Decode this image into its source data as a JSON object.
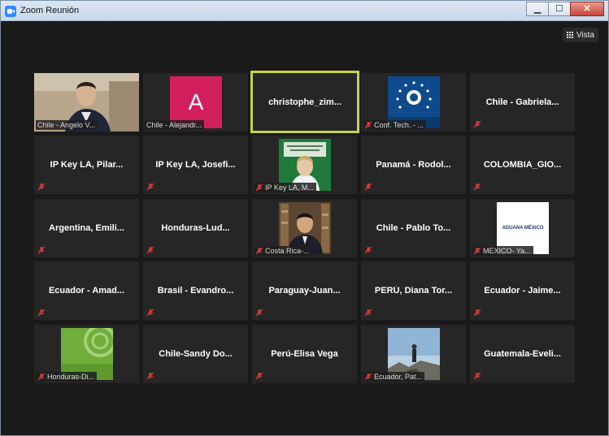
{
  "window": {
    "title": "Zoom Reunión",
    "controls": {
      "minimize": "▁",
      "maximize": "☐",
      "close": "✕"
    }
  },
  "toolbar": {
    "view_label": "Vista"
  },
  "participants": [
    {
      "id": "p1",
      "label": "Chile - Angelo V...",
      "kind": "video"
    },
    {
      "id": "p2",
      "label": "Chile - Alejandr...",
      "kind": "avatar",
      "avatar_letter": "A",
      "avatar_color": "#d41f5f"
    },
    {
      "id": "p3",
      "name": "christophe_zim...",
      "kind": "name",
      "active": true
    },
    {
      "id": "p4",
      "label": "Conf. Tech. - ...",
      "kind": "logo"
    },
    {
      "id": "p5",
      "name": "Chile - Gabriela...",
      "kind": "name"
    },
    {
      "id": "p6",
      "name": "IP Key LA, Pilar...",
      "kind": "name"
    },
    {
      "id": "p7",
      "name": "IP Key LA, Josefi...",
      "kind": "name"
    },
    {
      "id": "p8",
      "label": "IP Key LA, M...",
      "kind": "video"
    },
    {
      "id": "p9",
      "name": "Panamá - Rodol...",
      "kind": "name"
    },
    {
      "id": "p10",
      "name": "COLOMBIA_GIO...",
      "kind": "name"
    },
    {
      "id": "p11",
      "name": "Argentina, Emili...",
      "kind": "name"
    },
    {
      "id": "p12",
      "name": "Honduras-Lud...",
      "kind": "name"
    },
    {
      "id": "p13",
      "label": "Costa Rica-...",
      "kind": "video"
    },
    {
      "id": "p14",
      "name": "Chile - Pablo To...",
      "kind": "name"
    },
    {
      "id": "p15",
      "label": "MEXICO- Ya...",
      "kind": "logo",
      "logo_text": "ADUANA  MÉXICO"
    },
    {
      "id": "p16",
      "name": "Ecuador - Amad...",
      "kind": "name"
    },
    {
      "id": "p17",
      "name": "Brasil - Evandro...",
      "kind": "name"
    },
    {
      "id": "p18",
      "name": "Paraguay-Juan...",
      "kind": "name"
    },
    {
      "id": "p19",
      "name": "PERÚ, Diana Tor...",
      "kind": "name"
    },
    {
      "id": "p20",
      "name": "Ecuador - Jaime...",
      "kind": "name"
    },
    {
      "id": "p21",
      "label": "Honduras-Di...",
      "kind": "logo"
    },
    {
      "id": "p22",
      "name": "Chile-Sandy  Do...",
      "kind": "name"
    },
    {
      "id": "p23",
      "name": "Perú-Elisa Vega",
      "kind": "name"
    },
    {
      "id": "p24",
      "label": "Ecuador, Pat...",
      "kind": "video"
    },
    {
      "id": "p25",
      "name": "Guatemala-Eveli...",
      "kind": "name"
    }
  ],
  "colors": {
    "active_speaker_border": "#c7d44a",
    "muted_mic": "#e23b3b",
    "tile_bg": "#262626"
  }
}
